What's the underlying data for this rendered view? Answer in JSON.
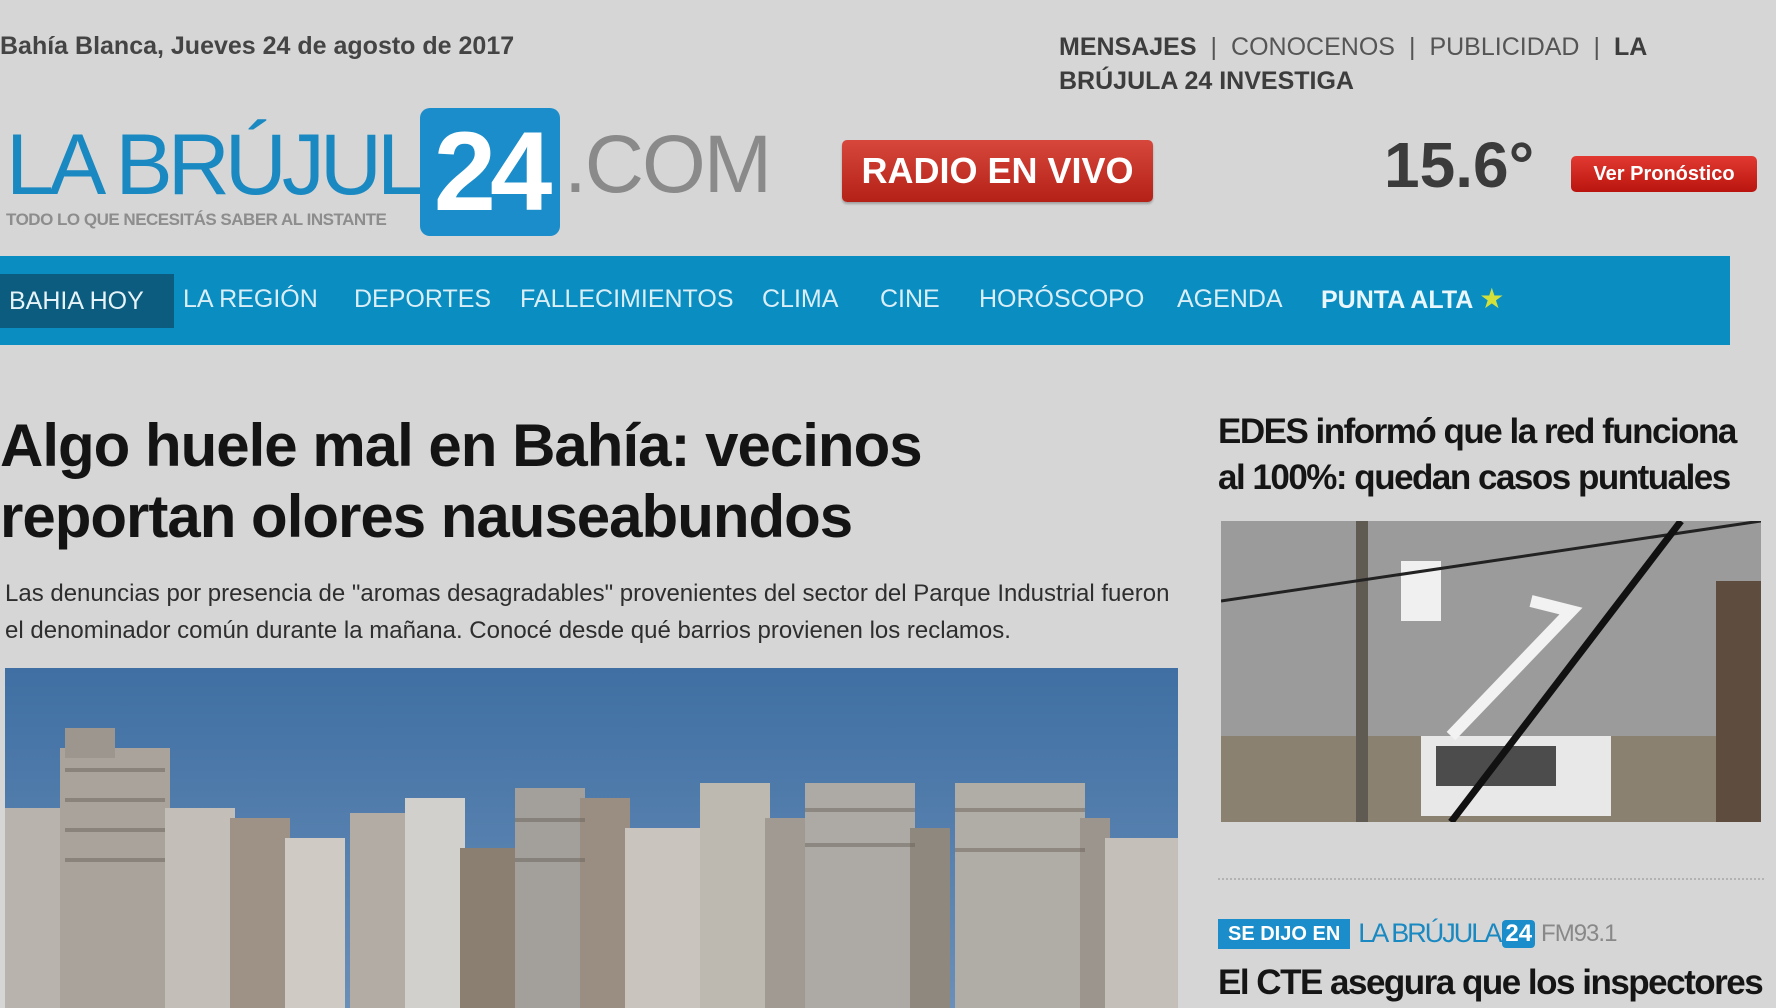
{
  "header": {
    "date": "Bahía Blanca, Jueves 24 de agosto de 2017",
    "links": [
      {
        "label": "MENSAJES",
        "bold": true
      },
      {
        "label": "CONOCENOS",
        "bold": false
      },
      {
        "label": "PUBLICIDAD",
        "bold": false
      },
      {
        "label": "LA BRÚJULA 24 INVESTIGA",
        "bold": true
      }
    ],
    "link_separator": "|"
  },
  "logo": {
    "text_main": "LA BRÚJULA",
    "text_number": "24",
    "text_suffix": ".COM",
    "tagline": "TODO LO QUE NECESITÁS SABER AL INSTANTE",
    "colors": {
      "blue": "#1a8dca",
      "gray": "#8a8a8a"
    }
  },
  "radio_button": "RADIO EN VIVO",
  "weather": {
    "temperature": "15.6°",
    "forecast_button": "Ver Pronóstico"
  },
  "nav": {
    "items": [
      "BAHIA HOY",
      "LA REGIÓN",
      "DEPORTES",
      "FALLECIMIENTOS",
      "CLIMA",
      "CINE",
      "HORÓSCOPO",
      "AGENDA",
      "PUNTA ALTA"
    ],
    "active_item": "BAHIA HOY",
    "highlight_item": "PUNTA ALTA",
    "bg_color": "#0a8ec2"
  },
  "main_article": {
    "headline": "Algo huele mal en Bahía: vecinos reportan olores nauseabundos",
    "summary": "Las denuncias por presencia de \"aromas desagradables\" provenientes del sector del Parque Industrial fueron el denominador común durante la mañana. Conocé desde qué barrios provienen los reclamos."
  },
  "side_article": {
    "headline": "EDES informó que la red funciona al 100%: quedan casos puntuales"
  },
  "se_dijo": {
    "tag": "SE DIJO EN",
    "brand": "LA BRÚJULA",
    "number": "24",
    "station": "FM93.1",
    "headline": "El CTE asegura que los inspectores"
  }
}
